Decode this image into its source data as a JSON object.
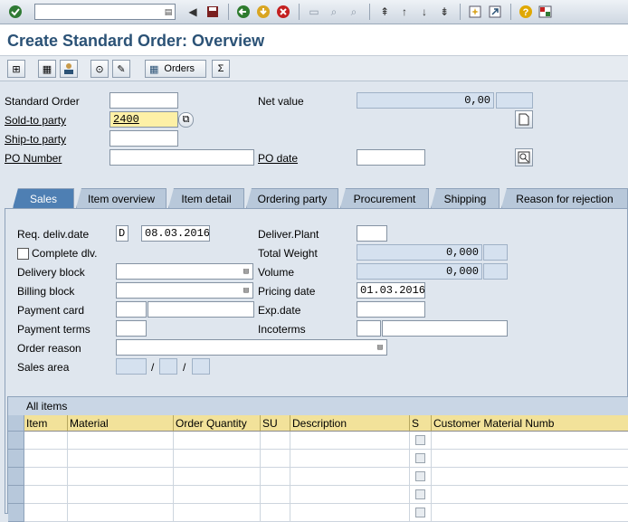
{
  "window": {
    "title": "Create Standard Order: Overview",
    "command_field_value": ""
  },
  "toolbar_icons": [
    "enter-icon",
    "back-icon",
    "save-icon",
    "nav-back-icon",
    "exit-icon",
    "cancel-icon",
    "print-icon",
    "find-icon",
    "find-next-icon",
    "first-page-icon",
    "prev-page-icon",
    "next-page-icon",
    "last-page-icon",
    "new-session-icon",
    "shortcut-icon",
    "help-icon",
    "layout-icon"
  ],
  "app_toolbar": {
    "orders_label": "Orders",
    "icons": [
      "display-doc-flow-icon",
      "header-details-icon",
      "business-partner-icon",
      "item-details-icon",
      "availability-icon",
      "orders-icon",
      "sigma-icon"
    ]
  },
  "header": {
    "standard_order": {
      "label": "Standard Order",
      "value": ""
    },
    "net_value": {
      "label": "Net value",
      "value": "0,00",
      "currency": ""
    },
    "sold_to_party": {
      "label": "Sold-to party",
      "value": "2400"
    },
    "ship_to_party": {
      "label": "Ship-to party",
      "value": ""
    },
    "po_number": {
      "label": "PO Number",
      "value": ""
    },
    "po_date": {
      "label": "PO date",
      "value": ""
    }
  },
  "tabs": [
    "Sales",
    "Item overview",
    "Item detail",
    "Ordering party",
    "Procurement",
    "Shipping",
    "Reason for rejection"
  ],
  "active_tab": "Sales",
  "sales": {
    "req_deliv_date": {
      "label": "Req. deliv.date",
      "format": "D",
      "value": "08.03.2016"
    },
    "complete_dlv": {
      "label": "Complete dlv.",
      "checked": false
    },
    "delivery_block": {
      "label": "Delivery block",
      "value": ""
    },
    "billing_block": {
      "label": "Billing block",
      "value": ""
    },
    "payment_card": {
      "label": "Payment card",
      "value": "",
      "value2": ""
    },
    "payment_terms": {
      "label": "Payment terms",
      "value": ""
    },
    "order_reason": {
      "label": "Order reason",
      "value": ""
    },
    "sales_area": {
      "label": "Sales area",
      "sep": "/"
    },
    "deliver_plant": {
      "label": "Deliver.Plant",
      "value": ""
    },
    "total_weight": {
      "label": "Total Weight",
      "value": "0,000",
      "unit": ""
    },
    "volume": {
      "label": "Volume",
      "value": "0,000",
      "unit": ""
    },
    "pricing_date": {
      "label": "Pricing date",
      "value": "01.03.2016"
    },
    "exp_date": {
      "label": "Exp.date",
      "value": ""
    },
    "incoterms": {
      "label": "Incoterms",
      "value": "",
      "value2": ""
    }
  },
  "items_table": {
    "title": "All items",
    "columns": [
      "Item",
      "Material",
      "Order Quantity",
      "SU",
      "Description",
      "S",
      "Customer Material Numb"
    ],
    "rows": [
      [
        "",
        "",
        "",
        "",
        "",
        "",
        ""
      ],
      [
        "",
        "",
        "",
        "",
        "",
        "",
        ""
      ],
      [
        "",
        "",
        "",
        "",
        "",
        "",
        ""
      ],
      [
        "",
        "",
        "",
        "",
        "",
        "",
        ""
      ],
      [
        "",
        "",
        "",
        "",
        "",
        "",
        ""
      ]
    ]
  }
}
